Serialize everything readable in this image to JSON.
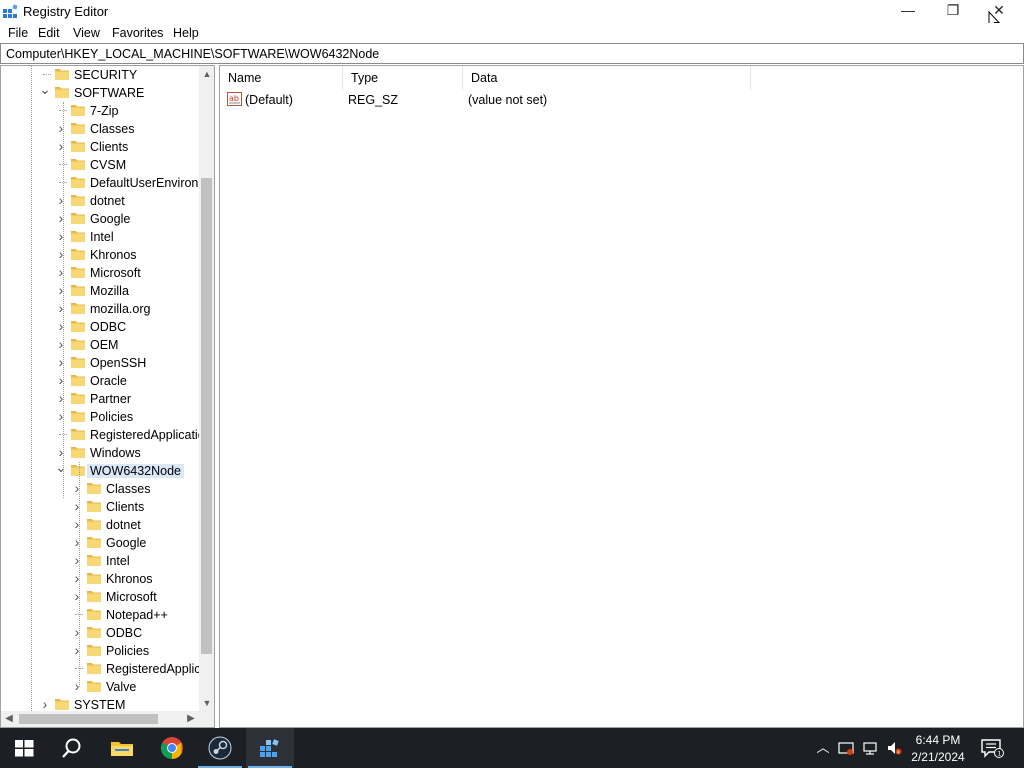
{
  "window": {
    "title": "Registry Editor",
    "minimize_glyph": "—",
    "maximize_glyph": "❐",
    "close_glyph": "✕"
  },
  "menu": {
    "items": [
      "File",
      "Edit",
      "View",
      "Favorites",
      "Help"
    ]
  },
  "address": {
    "path": "Computer\\HKEY_LOCAL_MACHINE\\SOFTWARE\\WOW6432Node"
  },
  "tree": {
    "items": [
      {
        "label": "SECURITY",
        "expander": "none"
      },
      {
        "label": "SOFTWARE",
        "expander": "expanded"
      },
      {
        "label": "7-Zip",
        "expander": "none"
      },
      {
        "label": "Classes",
        "expander": "collapsed"
      },
      {
        "label": "Clients",
        "expander": "collapsed"
      },
      {
        "label": "CVSM",
        "expander": "none"
      },
      {
        "label": "DefaultUserEnvironn",
        "expander": "none"
      },
      {
        "label": "dotnet",
        "expander": "collapsed"
      },
      {
        "label": "Google",
        "expander": "collapsed"
      },
      {
        "label": "Intel",
        "expander": "collapsed"
      },
      {
        "label": "Khronos",
        "expander": "collapsed"
      },
      {
        "label": "Microsoft",
        "expander": "collapsed"
      },
      {
        "label": "Mozilla",
        "expander": "collapsed"
      },
      {
        "label": "mozilla.org",
        "expander": "collapsed"
      },
      {
        "label": "ODBC",
        "expander": "collapsed"
      },
      {
        "label": "OEM",
        "expander": "collapsed"
      },
      {
        "label": "OpenSSH",
        "expander": "collapsed"
      },
      {
        "label": "Oracle",
        "expander": "collapsed"
      },
      {
        "label": "Partner",
        "expander": "collapsed"
      },
      {
        "label": "Policies",
        "expander": "collapsed"
      },
      {
        "label": "RegisteredApplicatic",
        "expander": "none"
      },
      {
        "label": "Windows",
        "expander": "collapsed"
      },
      {
        "label": "WOW6432Node",
        "expander": "expanded",
        "selected": true
      },
      {
        "label": "Classes",
        "expander": "collapsed"
      },
      {
        "label": "Clients",
        "expander": "collapsed"
      },
      {
        "label": "dotnet",
        "expander": "collapsed"
      },
      {
        "label": "Google",
        "expander": "collapsed"
      },
      {
        "label": "Intel",
        "expander": "collapsed"
      },
      {
        "label": "Khronos",
        "expander": "collapsed"
      },
      {
        "label": "Microsoft",
        "expander": "collapsed"
      },
      {
        "label": "Notepad++",
        "expander": "none"
      },
      {
        "label": "ODBC",
        "expander": "collapsed"
      },
      {
        "label": "Policies",
        "expander": "collapsed"
      },
      {
        "label": "RegisteredApplica",
        "expander": "none"
      },
      {
        "label": "Valve",
        "expander": "collapsed"
      },
      {
        "label": "SYSTEM",
        "expander": "collapsed"
      }
    ]
  },
  "values": {
    "columns": [
      "Name",
      "Type",
      "Data"
    ],
    "rows": [
      {
        "name": "(Default)",
        "type": "REG_SZ",
        "data": "(value not set)",
        "icon": "string-value-icon"
      }
    ]
  },
  "taskbar": {
    "apps": [
      {
        "name": "start",
        "icon": "windows-logo-icon"
      },
      {
        "name": "search",
        "icon": "search-icon"
      },
      {
        "name": "file-explorer",
        "icon": "folder-icon"
      },
      {
        "name": "chrome",
        "icon": "chrome-icon"
      },
      {
        "name": "steam",
        "icon": "steam-icon",
        "running": true
      },
      {
        "name": "registry-editor",
        "icon": "regedit-icon",
        "running": true,
        "active": true
      }
    ],
    "clock_time": "6:44 PM",
    "clock_date": "2/21/2024",
    "notification_count": "1"
  },
  "colors": {
    "taskbar_bg": "#1c2024",
    "folder_yellow": "#f8d775",
    "selection_bg": "#d9e8f7",
    "accent": "#6fb0e8"
  }
}
